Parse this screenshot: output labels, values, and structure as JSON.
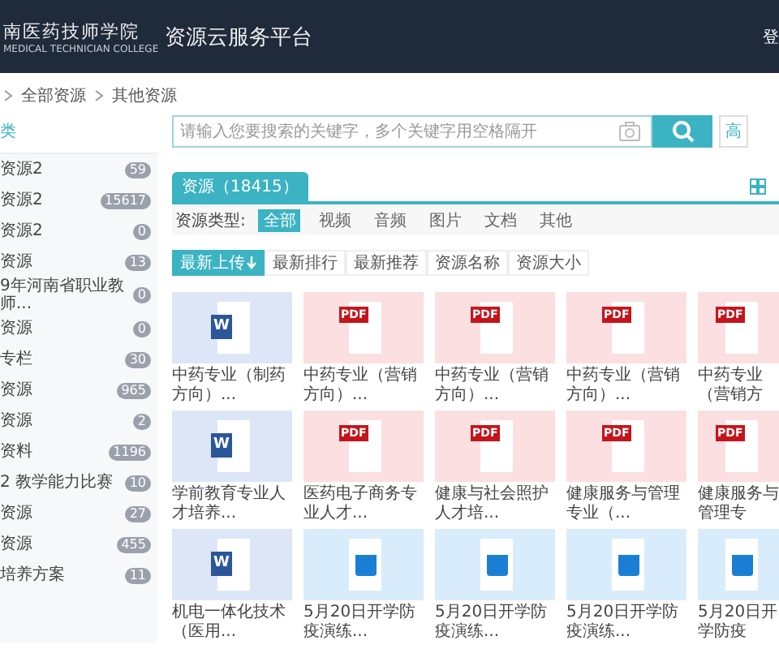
{
  "header": {
    "logo_text": "南医药技师学院",
    "logo_subtext": "MEDICAL TECHNICIAN COLLEGE",
    "title": "资源云服务平台",
    "login": "登"
  },
  "breadcrumb": [
    "全部资源",
    "其他资源"
  ],
  "sidebar": {
    "title": "类",
    "items": [
      {
        "label": "资源2",
        "count": "59"
      },
      {
        "label": "资源2",
        "count": "15617"
      },
      {
        "label": "资源2",
        "count": "0"
      },
      {
        "label": "资源",
        "count": "13"
      },
      {
        "label": "9年河南省职业教师...",
        "count": "0"
      },
      {
        "label": "资源",
        "count": "0"
      },
      {
        "label": "专栏",
        "count": "30"
      },
      {
        "label": "资源",
        "count": "965"
      },
      {
        "label": "资源",
        "count": "2"
      },
      {
        "label": "资料",
        "count": "1196"
      },
      {
        "label": "2 教学能力比赛",
        "count": "10"
      },
      {
        "label": "资源",
        "count": "27"
      },
      {
        "label": "资源",
        "count": "455"
      },
      {
        "label": "培养方案",
        "count": "11"
      }
    ]
  },
  "search": {
    "placeholder": "请输入您要搜索的关键字，多个关键字用空格隔开",
    "side_button": "高"
  },
  "tab": {
    "label": "资源（18415）"
  },
  "filter": {
    "label": "资源类型:",
    "options": [
      {
        "label": "全部",
        "selected": true
      },
      {
        "label": "视频",
        "selected": false
      },
      {
        "label": "音频",
        "selected": false
      },
      {
        "label": "图片",
        "selected": false
      },
      {
        "label": "文档",
        "selected": false
      },
      {
        "label": "其他",
        "selected": false
      }
    ]
  },
  "sort": [
    {
      "label": "最新上传",
      "selected": true
    },
    {
      "label": "最新排行",
      "selected": false
    },
    {
      "label": "最新推荐",
      "selected": false
    },
    {
      "label": "资源名称",
      "selected": false
    },
    {
      "label": "资源大小",
      "selected": false
    }
  ],
  "cards": [
    {
      "kind": "word",
      "icon_label": "W",
      "title": "中药专业（制药方向）..."
    },
    {
      "kind": "pdf",
      "icon_label": "PDF",
      "title": "中药专业（营销方向）..."
    },
    {
      "kind": "pdf",
      "icon_label": "PDF",
      "title": "中药专业（营销方向）..."
    },
    {
      "kind": "pdf",
      "icon_label": "PDF",
      "title": "中药专业（营销方向）..."
    },
    {
      "kind": "pdf",
      "icon_label": "PDF",
      "title": "中药专业（营销方"
    },
    {
      "kind": "word",
      "icon_label": "W",
      "title": "学前教育专业人才培养..."
    },
    {
      "kind": "pdf",
      "icon_label": "PDF",
      "title": "医药电子商务专业人才..."
    },
    {
      "kind": "pdf",
      "icon_label": "PDF",
      "title": "健康与社会照护人才培..."
    },
    {
      "kind": "pdf",
      "icon_label": "PDF",
      "title": "健康服务与管理专业（..."
    },
    {
      "kind": "pdf",
      "icon_label": "PDF",
      "title": "健康服务与管理专"
    },
    {
      "kind": "word",
      "icon_label": "W",
      "title": "机电一体化技术（医用..."
    },
    {
      "kind": "video",
      "title": "5月20日开学防疫演练..."
    },
    {
      "kind": "video",
      "title": "5月20日开学防疫演练..."
    },
    {
      "kind": "video",
      "title": "5月20日开学防疫演练..."
    },
    {
      "kind": "video",
      "title": "5月20日开学防疫"
    }
  ]
}
